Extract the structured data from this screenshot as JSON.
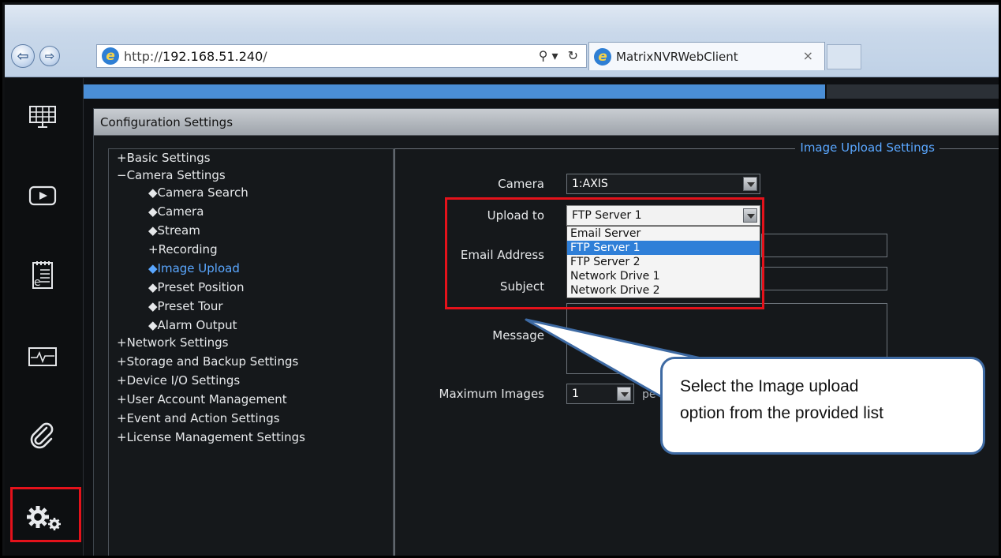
{
  "browser": {
    "url_scheme": "http://",
    "url_host": "192.168.51.240",
    "url_path": "/",
    "tab_title": "MatrixNVRWebClient",
    "tab_close": "×",
    "search_glyph": "⚲ ▾",
    "refresh_glyph": "↻"
  },
  "sidebar": {
    "items": [
      {
        "icon": "grid-layout-icon"
      },
      {
        "icon": "playback-icon"
      },
      {
        "icon": "event-log-icon"
      },
      {
        "icon": "system-health-icon"
      },
      {
        "icon": "attachment-icon"
      },
      {
        "icon": "settings-gears-icon"
      }
    ]
  },
  "config": {
    "title": "Configuration Settings",
    "tree": [
      {
        "label": "+Basic Settings"
      },
      {
        "label": "−Camera Settings"
      },
      {
        "label": "◆Camera Search"
      },
      {
        "label": "◆Camera"
      },
      {
        "label": "◆Stream"
      },
      {
        "label": "+Recording"
      },
      {
        "label": "◆Image Upload",
        "active": true
      },
      {
        "label": "◆Preset Position"
      },
      {
        "label": "◆Preset Tour"
      },
      {
        "label": "◆Alarm Output"
      },
      {
        "label": "+Network Settings"
      },
      {
        "label": "+Storage and Backup Settings"
      },
      {
        "label": "+Device I/O Settings"
      },
      {
        "label": "+User Account Management"
      },
      {
        "label": "+Event and Action Settings"
      },
      {
        "label": "+License Management Settings"
      }
    ]
  },
  "panel": {
    "legend": "Image Upload Settings",
    "camera_label": "Camera",
    "camera_value": "1:AXIS",
    "upload_label": "Upload to",
    "upload_value": "FTP Server 1",
    "upload_options": [
      "Email Server",
      "FTP Server 1",
      "FTP Server 2",
      "Network Drive 1",
      "Network Drive 2"
    ],
    "upload_selected_index": 1,
    "email_label": "Email Address",
    "subject_label": "Subject",
    "message_label": "Message",
    "max_images_label": "Maximum Images",
    "max_images_value": "1",
    "max_images_suffix": "pe"
  },
  "callout": {
    "line1": "Select the Image upload",
    "line2": "option from the provided list"
  },
  "colors": {
    "accent_blue": "#5aa7ff",
    "highlight_red": "#e4121b",
    "selection_blue": "#2f7fd8"
  }
}
